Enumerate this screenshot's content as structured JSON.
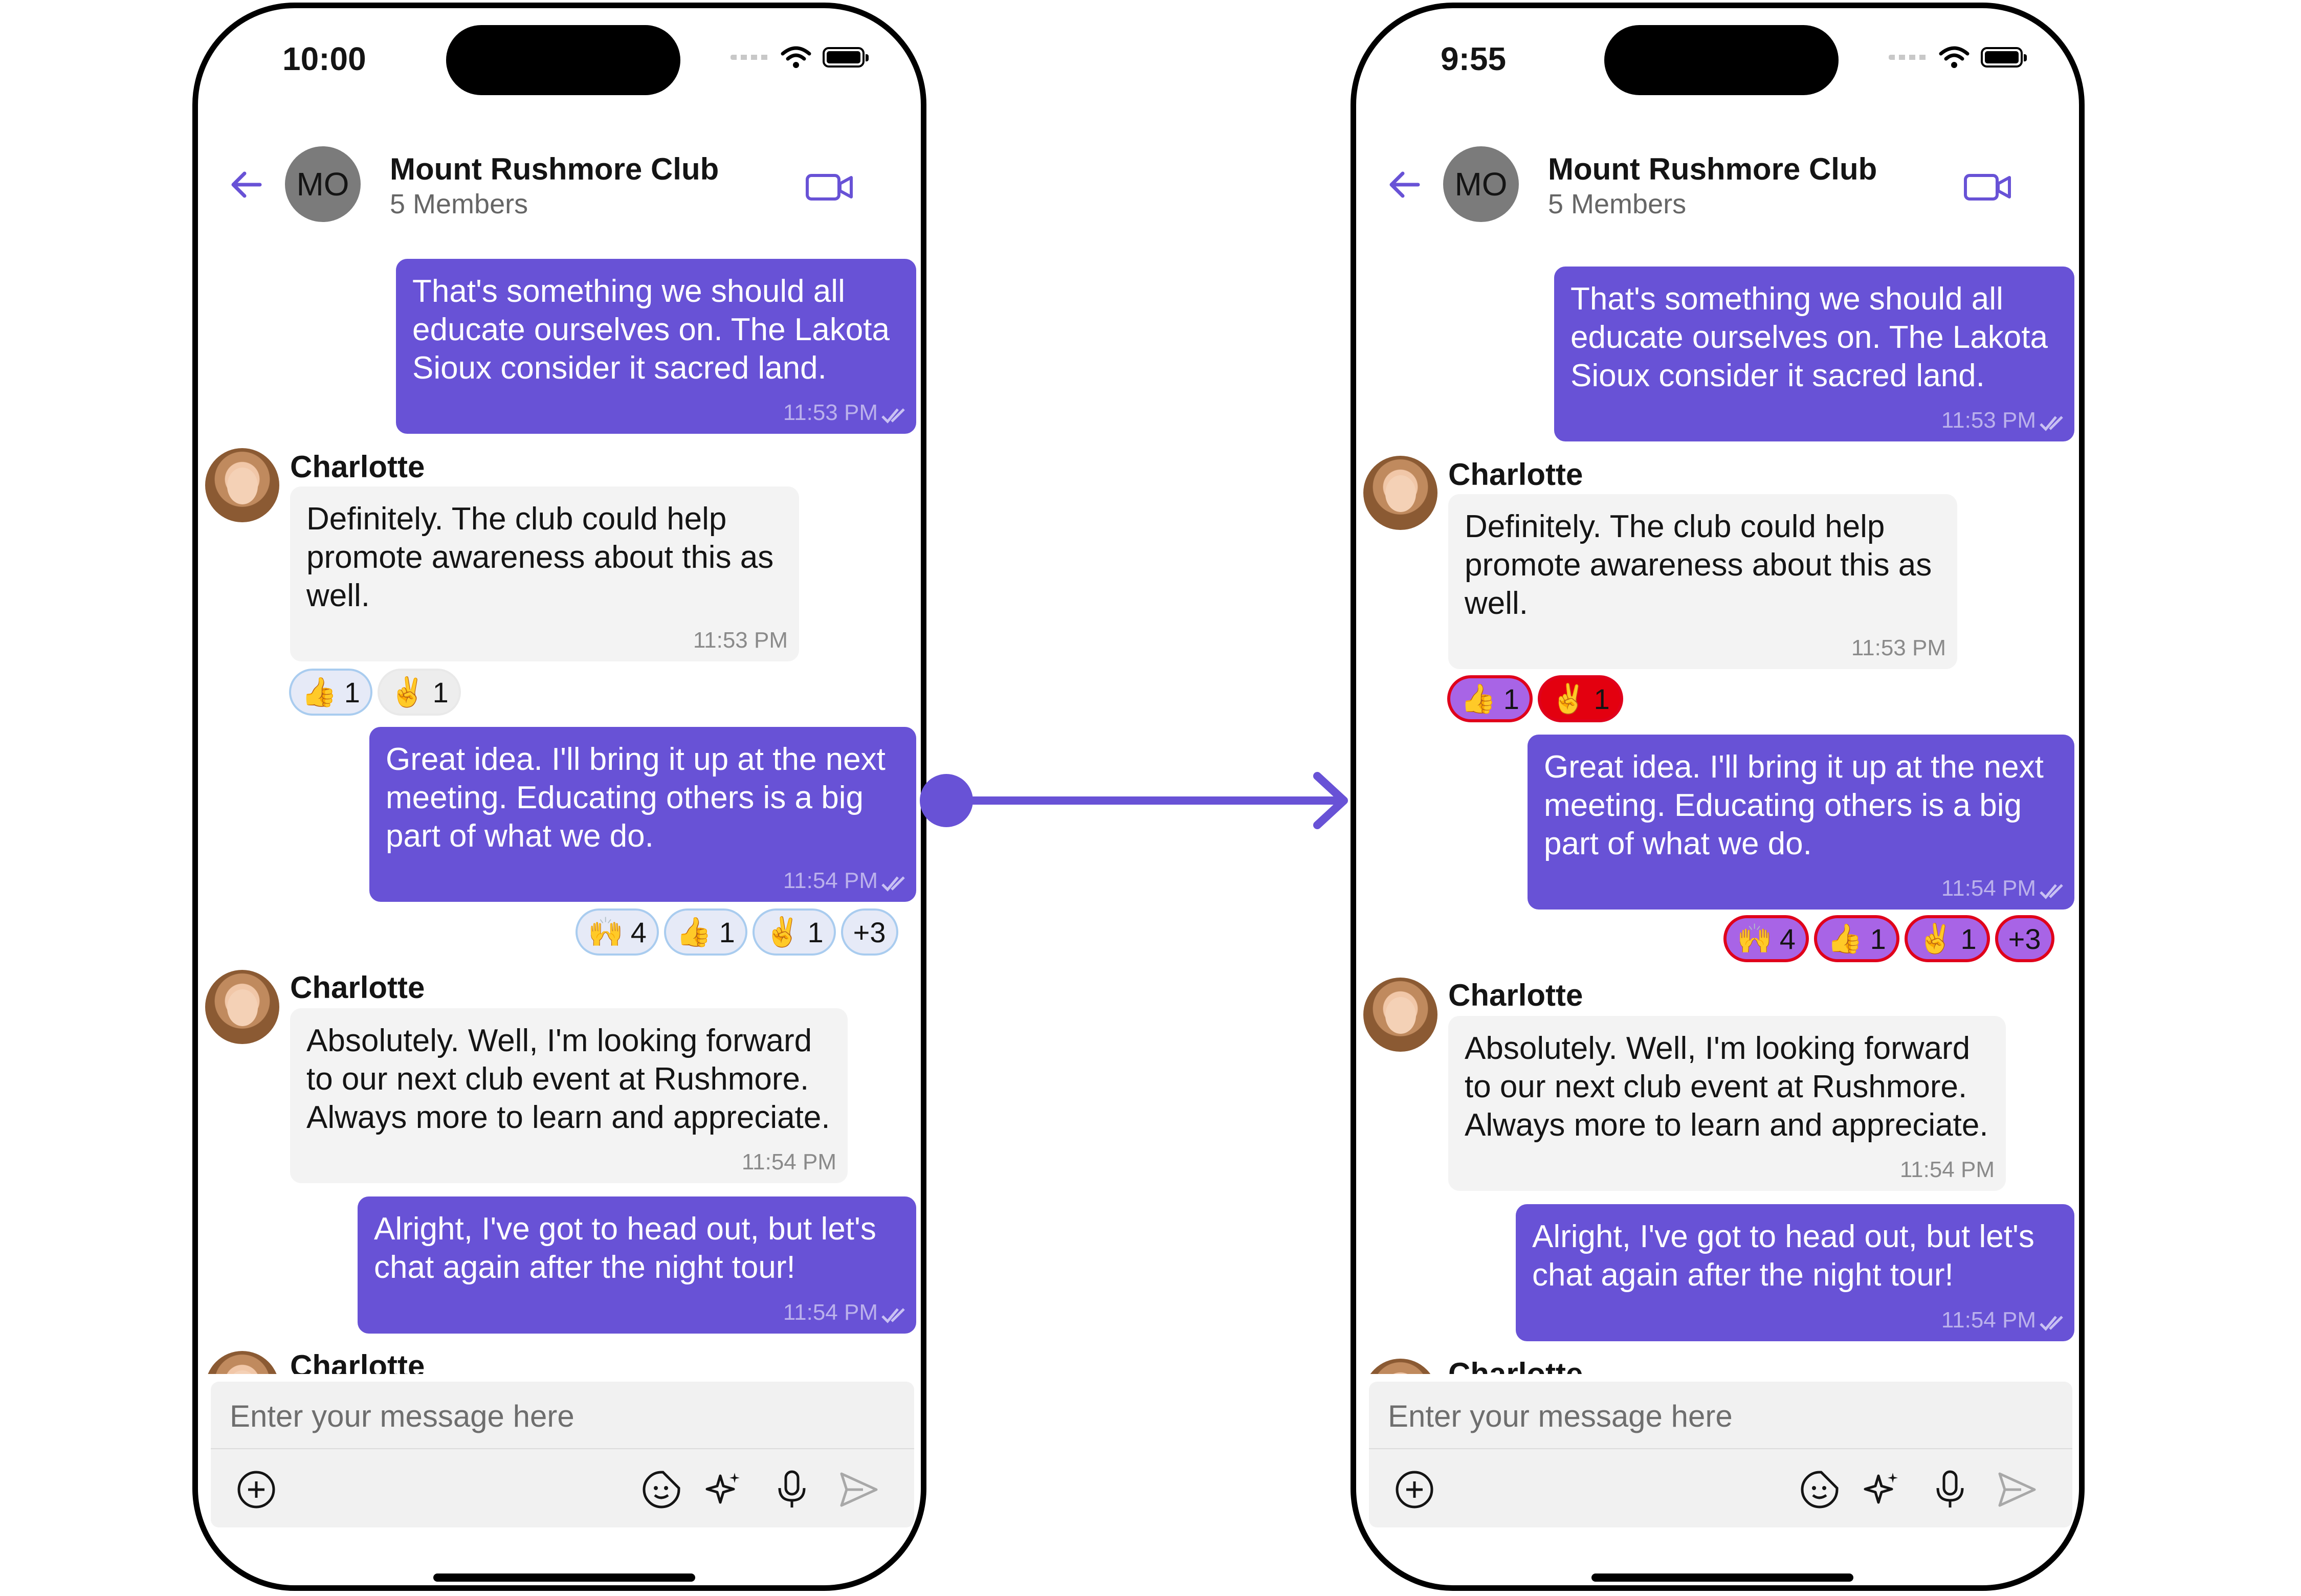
{
  "header": {
    "group_initials": "MO",
    "group_name": "Mount Rushmore Club",
    "members": "5 Members"
  },
  "screens": {
    "before": {
      "time": "10:00"
    },
    "after": {
      "time": "9:55"
    }
  },
  "messages": [
    {
      "direction": "outgoing",
      "text": "That's something we should all\neducate ourselves on. The Lakota\nSioux consider it sacred land.",
      "time": "11:53 PM"
    },
    {
      "direction": "incoming",
      "sender": "Charlotte",
      "text": "Definitely. The club could help\npromote awareness about this as\nwell.",
      "time": "11:53 PM",
      "reactions": [
        {
          "emoji": "👍",
          "count": "1"
        },
        {
          "emoji": "✌️",
          "count": "1"
        }
      ]
    },
    {
      "direction": "outgoing",
      "text": "Great idea. I'll bring it up at the next\nmeeting. Educating others is a big\npart of what we do.",
      "time": "11:54 PM",
      "reactions": [
        {
          "emoji": "🙌",
          "count": "4"
        },
        {
          "emoji": "👍",
          "count": "1"
        },
        {
          "emoji": "✌️",
          "count": "1"
        },
        {
          "more": "+3"
        }
      ]
    },
    {
      "direction": "incoming",
      "sender": "Charlotte",
      "text": "Absolutely. Well, I'm looking forward\nto our next club event at Rushmore.\nAlways more to learn and appreciate.",
      "time": "11:54 PM"
    },
    {
      "direction": "outgoing",
      "text": "Alright, I've got to head out, but let's\nchat again after the night tour!",
      "time": "11:54 PM"
    },
    {
      "direction": "incoming",
      "sender": "Charlotte"
    }
  ],
  "composer": {
    "placeholder": "Enter your message here"
  },
  "icons": {
    "back": "arrow-left-icon",
    "video": "video-camera-icon",
    "attach": "plus-circle-icon",
    "sticker": "sticker-icon",
    "ai": "sparkles-icon",
    "mic": "microphone-icon",
    "send": "send-icon",
    "read": "double-check-icon"
  },
  "colors": {
    "accent": "#6852d6",
    "incoming_bubble": "#f3f3f3",
    "reaction_default_border": "#a9ccef",
    "reaction_default_bg": "#e6eaf7",
    "reaction_custom_border": "#e0001b",
    "reaction_custom_bg": "#a864e6",
    "reaction_custom_bg_alt": "#e3000f"
  }
}
